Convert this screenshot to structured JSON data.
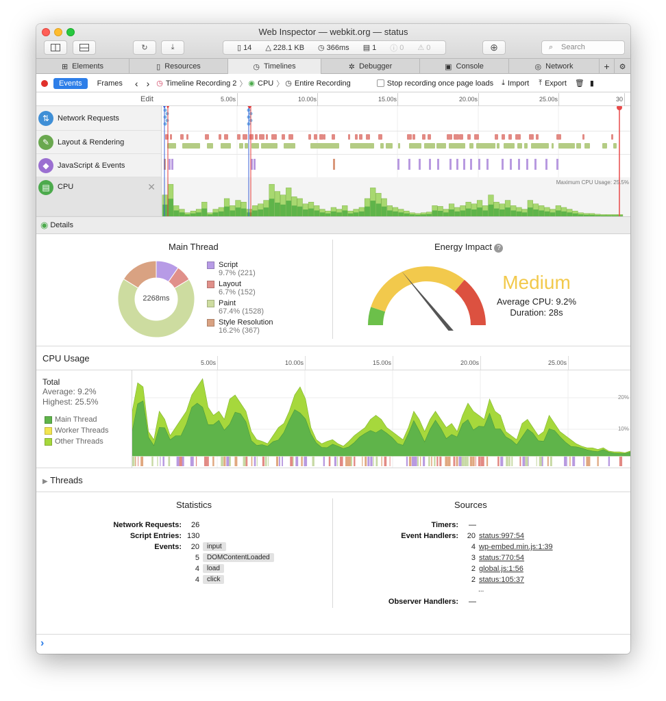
{
  "window": {
    "title": "Web Inspector — webkit.org — status",
    "traffic_colors": [
      "#ff5f57",
      "#febc2e",
      "#28c840"
    ]
  },
  "toolbar": {
    "resources_count": "14",
    "size": "228.1 KB",
    "time": "366ms",
    "messages": "1",
    "errors": "0",
    "warnings": "0",
    "search_placeholder": "Search"
  },
  "tabs": [
    {
      "label": "Elements",
      "icon": "elements-icon"
    },
    {
      "label": "Resources",
      "icon": "document-icon"
    },
    {
      "label": "Timelines",
      "icon": "clock-icon"
    },
    {
      "label": "Debugger",
      "icon": "bug-icon"
    },
    {
      "label": "Console",
      "icon": "console-icon"
    },
    {
      "label": "Network",
      "icon": "network-icon"
    }
  ],
  "navbar": {
    "events": "Events",
    "frames": "Frames",
    "recording": "Timeline Recording 2",
    "cpu": "CPU",
    "entire": "Entire Recording",
    "stop_label": "Stop recording once page loads",
    "import": "Import",
    "export": "Export"
  },
  "ruler": {
    "edit": "Edit",
    "ticks": [
      "5.00s",
      "10.00s",
      "15.00s",
      "20.00s",
      "25.00s",
      "30"
    ]
  },
  "timelines": [
    {
      "label": "Network Requests",
      "color": "#3f8fd6"
    },
    {
      "label": "Layout & Rendering",
      "color": "#6aa84f"
    },
    {
      "label": "JavaScript & Events",
      "color": "#9b6fd1"
    },
    {
      "label": "CPU",
      "color": "#4caa4c"
    }
  ],
  "cpu_max_label": "Maximum CPU Usage: 25.5%",
  "details_label": "Details",
  "main_thread": {
    "title": "Main Thread",
    "center": "2268ms",
    "items": [
      {
        "name": "Script",
        "value": "9.7% (221)",
        "pct": 9.7,
        "color": "#b79be6"
      },
      {
        "name": "Layout",
        "value": "6.7% (152)",
        "pct": 6.7,
        "color": "#e0908a"
      },
      {
        "name": "Paint",
        "value": "67.4% (1528)",
        "pct": 67.4,
        "color": "#cddca0"
      },
      {
        "name": "Style Resolution",
        "value": "16.2% (367)",
        "pct": 16.2,
        "color": "#d9a282"
      }
    ]
  },
  "energy": {
    "title": "Energy Impact",
    "level": "Medium",
    "avg": "Average CPU: 9.2%",
    "duration": "Duration: 28s",
    "needle_fraction": 0.36,
    "colors": {
      "low": "#6cc04a",
      "medium": "#f2c94c",
      "high": "#dc5140",
      "text": "#f2c94c"
    }
  },
  "cpu_usage": {
    "title": "CPU Usage",
    "total": "Total",
    "average": "Average: 9.2%",
    "highest": "Highest: 25.5%",
    "legend": [
      {
        "name": "Main Thread",
        "color": "#5fb44a"
      },
      {
        "name": "Worker Threads",
        "color": "#f2e550"
      },
      {
        "name": "Other Threads",
        "color": "#a6d83c"
      }
    ],
    "ticks": [
      "5.00s",
      "10.00s",
      "15.00s",
      "20.00s",
      "25.00s"
    ],
    "y_labels": [
      "20%",
      "10%"
    ]
  },
  "threads_label": "Threads",
  "statistics": {
    "title": "Statistics",
    "network_label": "Network Requests:",
    "network_value": "26",
    "script_label": "Script Entries:",
    "script_value": "130",
    "events_label": "Events:",
    "events": [
      {
        "count": "20",
        "name": "input"
      },
      {
        "count": "5",
        "name": "DOMContentLoaded"
      },
      {
        "count": "4",
        "name": "load"
      },
      {
        "count": "4",
        "name": "click"
      }
    ]
  },
  "sources": {
    "title": "Sources",
    "timers_label": "Timers:",
    "timers_value": "—",
    "handlers_label": "Event Handlers:",
    "handlers": [
      {
        "count": "20",
        "link": "status:997:54"
      },
      {
        "count": "4",
        "link": "wp-embed.min.js:1:39"
      },
      {
        "count": "3",
        "link": "status:770:54"
      },
      {
        "count": "2",
        "link": "global.js:1:56"
      },
      {
        "count": "2",
        "link": "status:105:37"
      }
    ],
    "ellipsis": "...",
    "observer_label": "Observer Handlers:",
    "observer_value": "—"
  },
  "console_prompt": "›"
}
